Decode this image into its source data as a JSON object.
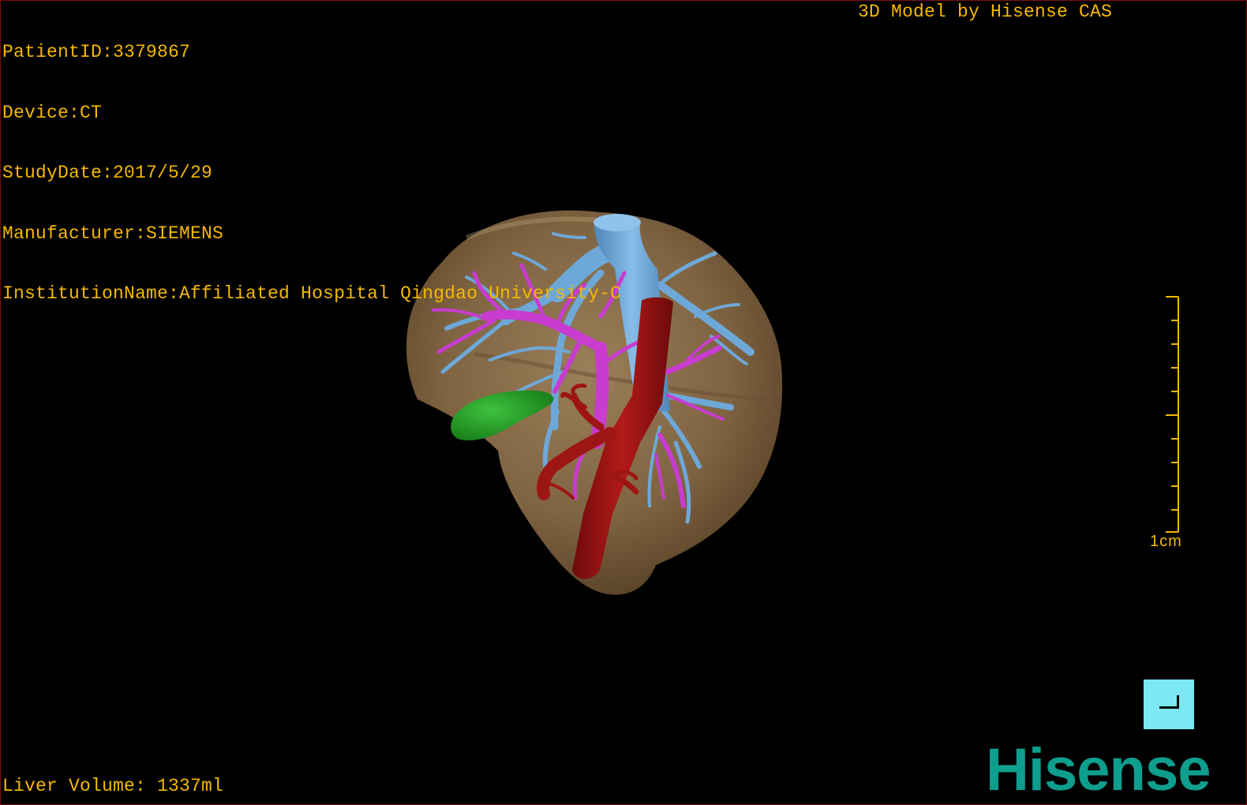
{
  "header_info": {
    "patient_id": "PatientID:3379867",
    "device": "Device:CT",
    "study_date": "StudyDate:2017/5/29",
    "manufacturer": "Manufacturer:SIEMENS",
    "institution": "InstitutionName:Affiliated Hospital Qingdao University-C"
  },
  "model_credit": "3D Model by Hisense CAS",
  "liver_volume": "Liver Volume: 1337ml",
  "scale": {
    "label": "1cm"
  },
  "brand": {
    "logo_text": "Hisense"
  },
  "colors": {
    "overlay_text": "#f5b800",
    "liver": "#8c6f4a",
    "hepatic_vein": "#6ea8d8",
    "portal_vein": "#c83ccf",
    "artery": "#9e1515",
    "gallbladder": "#1f9a1f",
    "logo": "#0e9e8e",
    "corner_button": "#7de8f3"
  },
  "icons": {
    "corner_button": "corner-bracket-icon"
  }
}
